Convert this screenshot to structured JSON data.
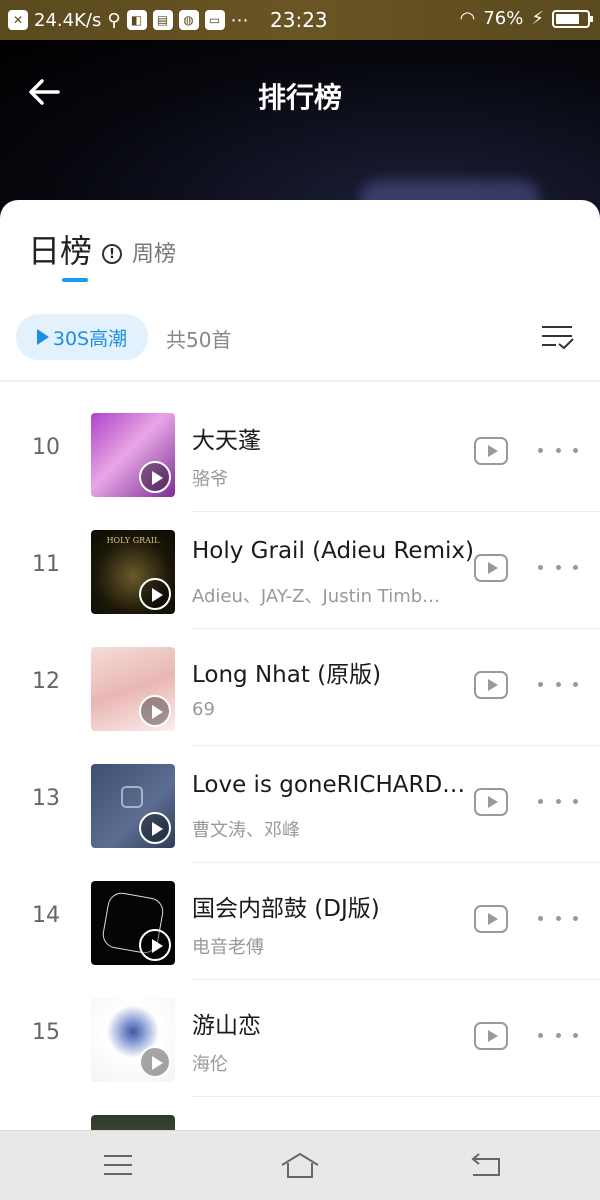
{
  "status_bar": {
    "net_speed": "24.4K/s",
    "time": "23:23",
    "battery": "76%",
    "battery_level": 0.76,
    "indicators": [
      "x-icon",
      "usb-icon",
      "sim-icon",
      "id-card-icon",
      "vpn-icon",
      "screen-icon"
    ]
  },
  "header": {
    "title": "排行榜",
    "back_icon": "arrow-left-icon"
  },
  "tabs": {
    "daily": "日榜",
    "weekly": "周榜"
  },
  "toolbar": {
    "play_label": "30S高潮",
    "count_label": "共50首"
  },
  "songs": [
    {
      "rank": "10",
      "title": "大天蓬",
      "artist": "骆爷"
    },
    {
      "rank": "11",
      "title": "Holy Grail (Adieu Remix)",
      "artist": "Adieu、JAY-Z、Justin Timb…",
      "cover_text": "HOLY GRAIL"
    },
    {
      "rank": "12",
      "title": "Long Nhat (原版)",
      "artist": "69"
    },
    {
      "rank": "13",
      "title": "Love is goneRICHARD…",
      "artist": "曹文涛、邓峰"
    },
    {
      "rank": "14",
      "title": "国会内部鼓 (DJ版)",
      "artist": "电音老傅"
    },
    {
      "rank": "15",
      "title": "游山恋",
      "artist": "海伦"
    }
  ],
  "colors": {
    "accent": "#1a9cf0",
    "pill_bg": "#e3f1fc",
    "status_bar": "#5a4a1e"
  },
  "nav": [
    "menu-icon",
    "home-icon",
    "back-icon"
  ]
}
